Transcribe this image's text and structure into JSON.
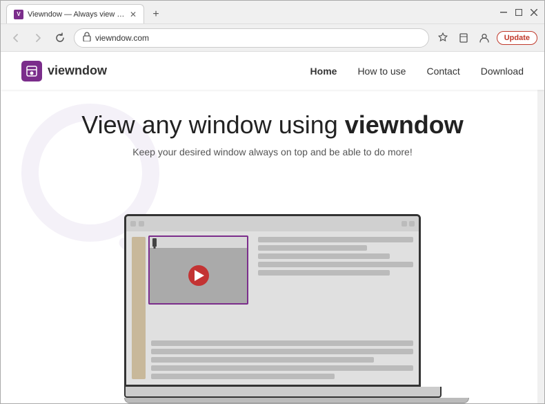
{
  "browser": {
    "title_bar": {
      "tab_title": "Viewndow — Always view desir...",
      "favicon_label": "V",
      "new_tab_label": "+",
      "window_controls": {
        "minimize": "—",
        "maximize": "□",
        "close": "✕"
      }
    },
    "address_bar": {
      "back_label": "←",
      "forward_label": "→",
      "refresh_label": "↻",
      "lock_icon": "🔒",
      "url": "viewndow.com",
      "star_icon": "☆",
      "bookmark_icon": "⊟",
      "account_icon": "👤",
      "update_label": "Update"
    }
  },
  "site": {
    "logo_text": "viewndow",
    "nav": {
      "links": [
        {
          "label": "Home",
          "active": true
        },
        {
          "label": "How to use",
          "active": false
        },
        {
          "label": "Contact",
          "active": false
        },
        {
          "label": "Download",
          "active": false
        }
      ]
    },
    "hero": {
      "title_normal": "View any window using ",
      "title_bold": "viewndow",
      "subtitle": "Keep your desired window always on top and be able to do more!",
      "watermark_text": "viewndow"
    }
  }
}
